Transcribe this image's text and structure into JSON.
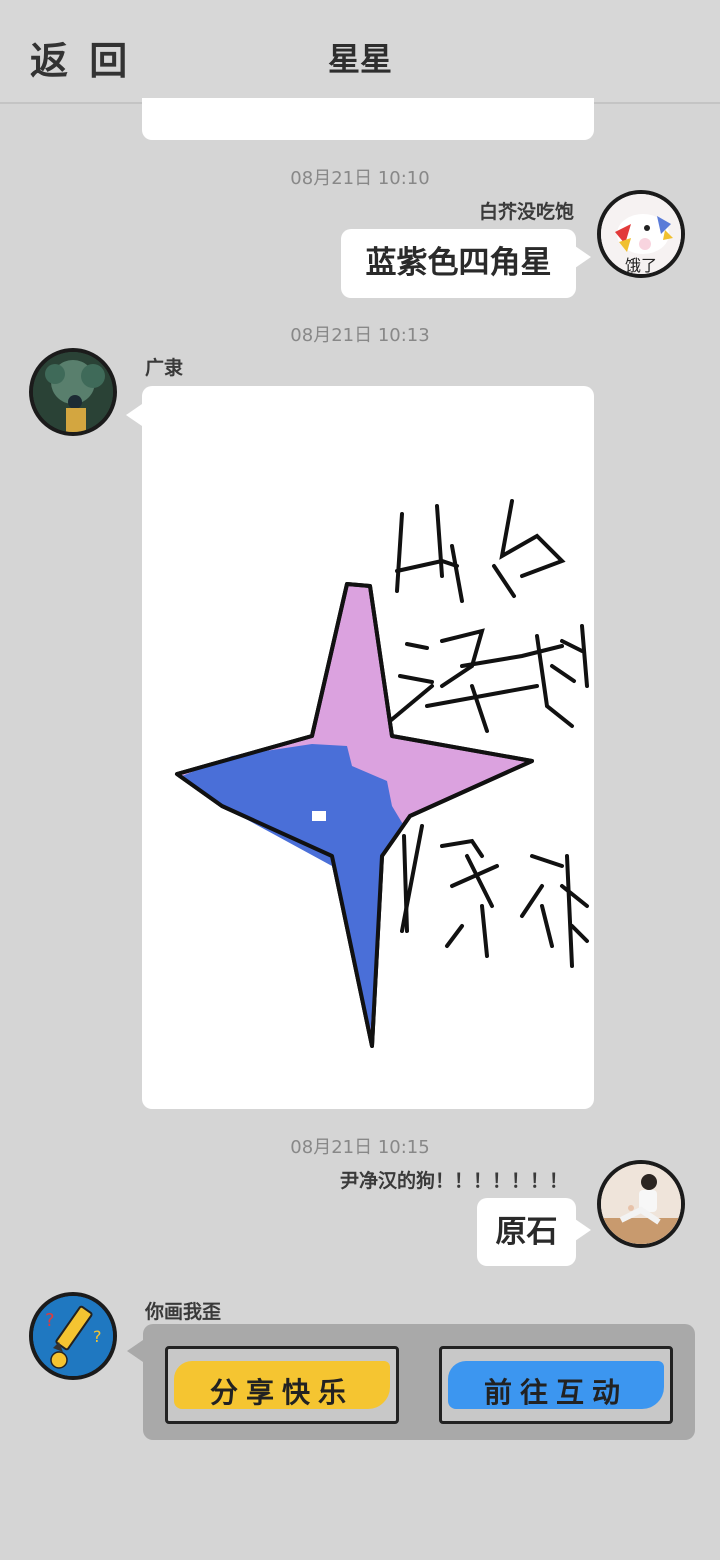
{
  "header": {
    "back_label": "返 回",
    "title": "星星"
  },
  "messages": [
    {
      "time": "08月21日  10:10",
      "sender": "白芥没吃饱",
      "text": "蓝紫色四角星",
      "side": "right"
    },
    {
      "time": "08月21日  10:13",
      "sender": "广隶",
      "type": "drawing",
      "side": "left"
    },
    {
      "time": "08月21日  10:15",
      "sender": "尹净汉的狗！！！！！！！",
      "text": "原石",
      "side": "right"
    },
    {
      "sender": "你画我歪",
      "side": "left",
      "type": "card",
      "buttons": [
        {
          "label": "分享快乐",
          "color": "#f5c531"
        },
        {
          "label": "前往互动",
          "color": "#3c96f0"
        }
      ]
    }
  ],
  "drawing": {
    "star_colors": {
      "light": "#dba2df",
      "dark": "#4a6fd8"
    }
  },
  "avatar_texts": {
    "avatar1_caption": "饿了"
  },
  "colors": {
    "background": "#d5d5d5",
    "bubble": "#ffffff",
    "card": "#a9a9a9"
  }
}
